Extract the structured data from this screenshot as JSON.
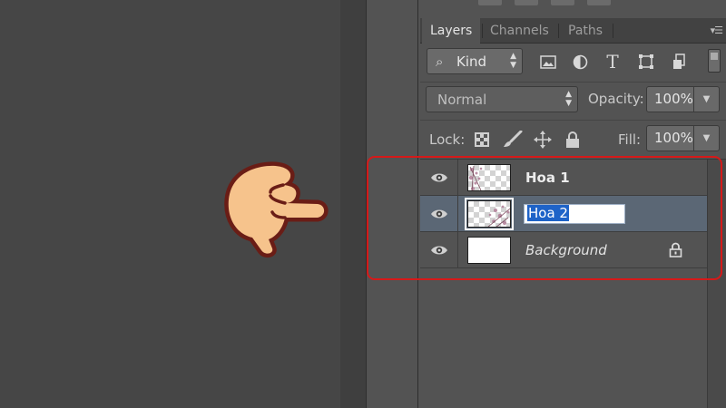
{
  "panel": {
    "tabs": [
      {
        "label": "Layers",
        "active": true
      },
      {
        "label": "Channels",
        "active": false
      },
      {
        "label": "Paths",
        "active": false
      }
    ],
    "filter": {
      "kind_label": "Kind",
      "icons": [
        "image-filter-icon",
        "adjustment-filter-icon",
        "type-filter-icon",
        "shape-filter-icon",
        "smart-object-filter-icon"
      ]
    },
    "blend": {
      "mode": "Normal",
      "opacity_label": "Opacity:",
      "opacity_value": "100%"
    },
    "lock": {
      "label": "Lock:",
      "icons": [
        "lock-transparent-pixels-icon",
        "lock-image-pixels-icon",
        "lock-position-icon",
        "lock-all-icon"
      ],
      "fill_label": "Fill:",
      "fill_value": "100%"
    },
    "layers": [
      {
        "name": "Hoa 1",
        "visible": true,
        "selected": false,
        "editing": false
      },
      {
        "name": "Hoa 2",
        "visible": true,
        "selected": true,
        "editing": true
      },
      {
        "name": "Background",
        "visible": true,
        "selected": false,
        "locked": true,
        "italic": true
      }
    ]
  },
  "colors": {
    "selection_highlight": "#5b6775",
    "annotation_red": "#d61919",
    "text_selection": "#1e63c8"
  }
}
